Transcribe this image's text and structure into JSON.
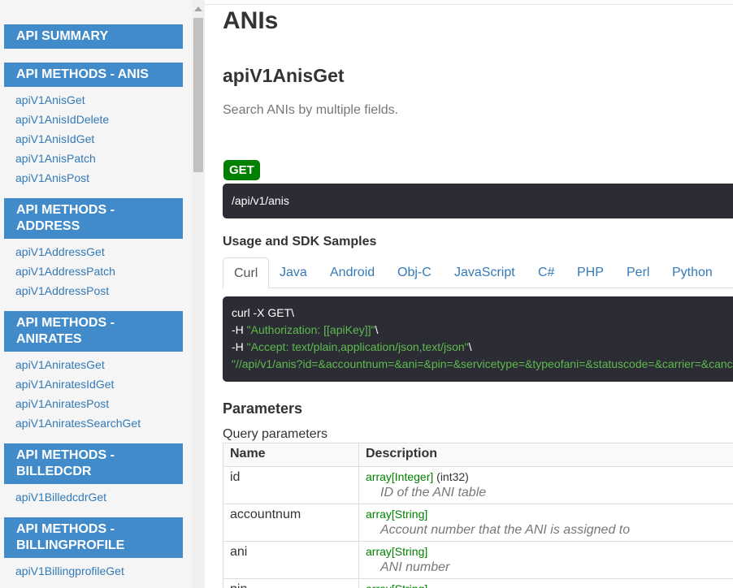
{
  "sidebar": {
    "sections": [
      {
        "label": "API SUMMARY",
        "label2": "",
        "links": []
      },
      {
        "label": "API METHODS - ANIS",
        "label2": "",
        "links": [
          "apiV1AnisGet",
          "apiV1AnisIdDelete",
          "apiV1AnisIdGet",
          "apiV1AnisPatch",
          "apiV1AnisPost"
        ]
      },
      {
        "label": "API METHODS -",
        "label2": "ADDRESS",
        "links": [
          "apiV1AddressGet",
          "apiV1AddressPatch",
          "apiV1AddressPost"
        ]
      },
      {
        "label": "API METHODS -",
        "label2": "ANIRATES",
        "links": [
          "apiV1AniratesGet",
          "apiV1AniratesIdGet",
          "apiV1AniratesPost",
          "apiV1AniratesSearchGet"
        ]
      },
      {
        "label": "API METHODS -",
        "label2": "BILLEDCDR",
        "links": [
          "apiV1BilledcdrGet"
        ]
      },
      {
        "label": "API METHODS -",
        "label2": "BILLINGPROFILE",
        "links": [
          "apiV1BillingprofileGet"
        ]
      }
    ]
  },
  "main": {
    "page_title": "ANIs",
    "method_title": "apiV1AnisGet",
    "method_desc": "Search ANIs by multiple fields.",
    "verb": "GET",
    "path": "/api/v1/anis",
    "usage_heading": "Usage and SDK Samples",
    "tabs": [
      "Curl",
      "Java",
      "Android",
      "Obj-C",
      "JavaScript",
      "C#",
      "PHP",
      "Perl",
      "Python"
    ],
    "code": {
      "line1": "curl -X GET\\",
      "line2_prefix": "-H ",
      "line2_str": "\"Authorization: [[apiKey]]\"",
      "line2_suffix": "\\",
      "line3_prefix": "-H ",
      "line3_str": "\"Accept: text/plain,application/json,text/json\"",
      "line3_suffix": "\\",
      "line4_str": "\"//api/v1/anis?id=&accountnum=&ani=&pin=&servicetype=&typeofani=&statuscode=&carrier=&canc"
    },
    "params_heading": "Parameters",
    "query_label": "Query parameters",
    "table": {
      "col_name": "Name",
      "col_desc": "Description",
      "rows": [
        {
          "name": "id",
          "type": "array[Integer]",
          "format": " (int32)",
          "desc": "ID of the ANI table"
        },
        {
          "name": "accountnum",
          "type": "array[String]",
          "format": "",
          "desc": "Account number that the ANI is assigned to"
        },
        {
          "name": "ani",
          "type": "array[String]",
          "format": "",
          "desc": "ANI number"
        },
        {
          "name": "pin",
          "type": "array[String]",
          "format": "",
          "desc": ""
        }
      ]
    }
  },
  "colors": {
    "section_bg": "#428bca",
    "link": "#337ab7",
    "verb_get": "#008000",
    "code_bg": "#2b2c34",
    "code_string": "#5fba4f"
  }
}
